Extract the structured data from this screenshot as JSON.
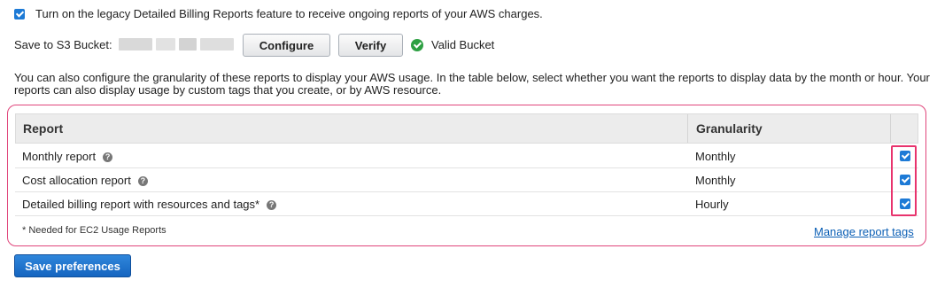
{
  "legacy": {
    "checked": true,
    "label": "Turn on the legacy Detailed Billing Reports feature to receive ongoing reports of your AWS charges."
  },
  "bucket": {
    "label": "Save to S3 Bucket:",
    "configure_label": "Configure",
    "verify_label": "Verify",
    "status_label": "Valid Bucket"
  },
  "description": [
    "You can also configure the granularity of these reports to display your AWS usage. In the table below, select whether you want the reports to display data by the month or hour. Your",
    "reports can also display usage by custom tags that you create, or by AWS resource."
  ],
  "table": {
    "headers": {
      "report": "Report",
      "granularity": "Granularity"
    },
    "rows": [
      {
        "report": "Monthly report",
        "granularity": "Monthly",
        "checked": true
      },
      {
        "report": "Cost allocation report",
        "granularity": "Monthly",
        "checked": true
      },
      {
        "report": "Detailed billing report with resources and tags*",
        "granularity": "Hourly",
        "checked": true
      }
    ],
    "footnote": "* Needed for EC2 Usage Reports",
    "manage_tags_label": "Manage report tags"
  },
  "save_label": "Save preferences",
  "colors": {
    "accent": "#1d7ad6",
    "highlight": "#e8336d",
    "valid": "#2ea043",
    "link": "#0b5fb5"
  }
}
